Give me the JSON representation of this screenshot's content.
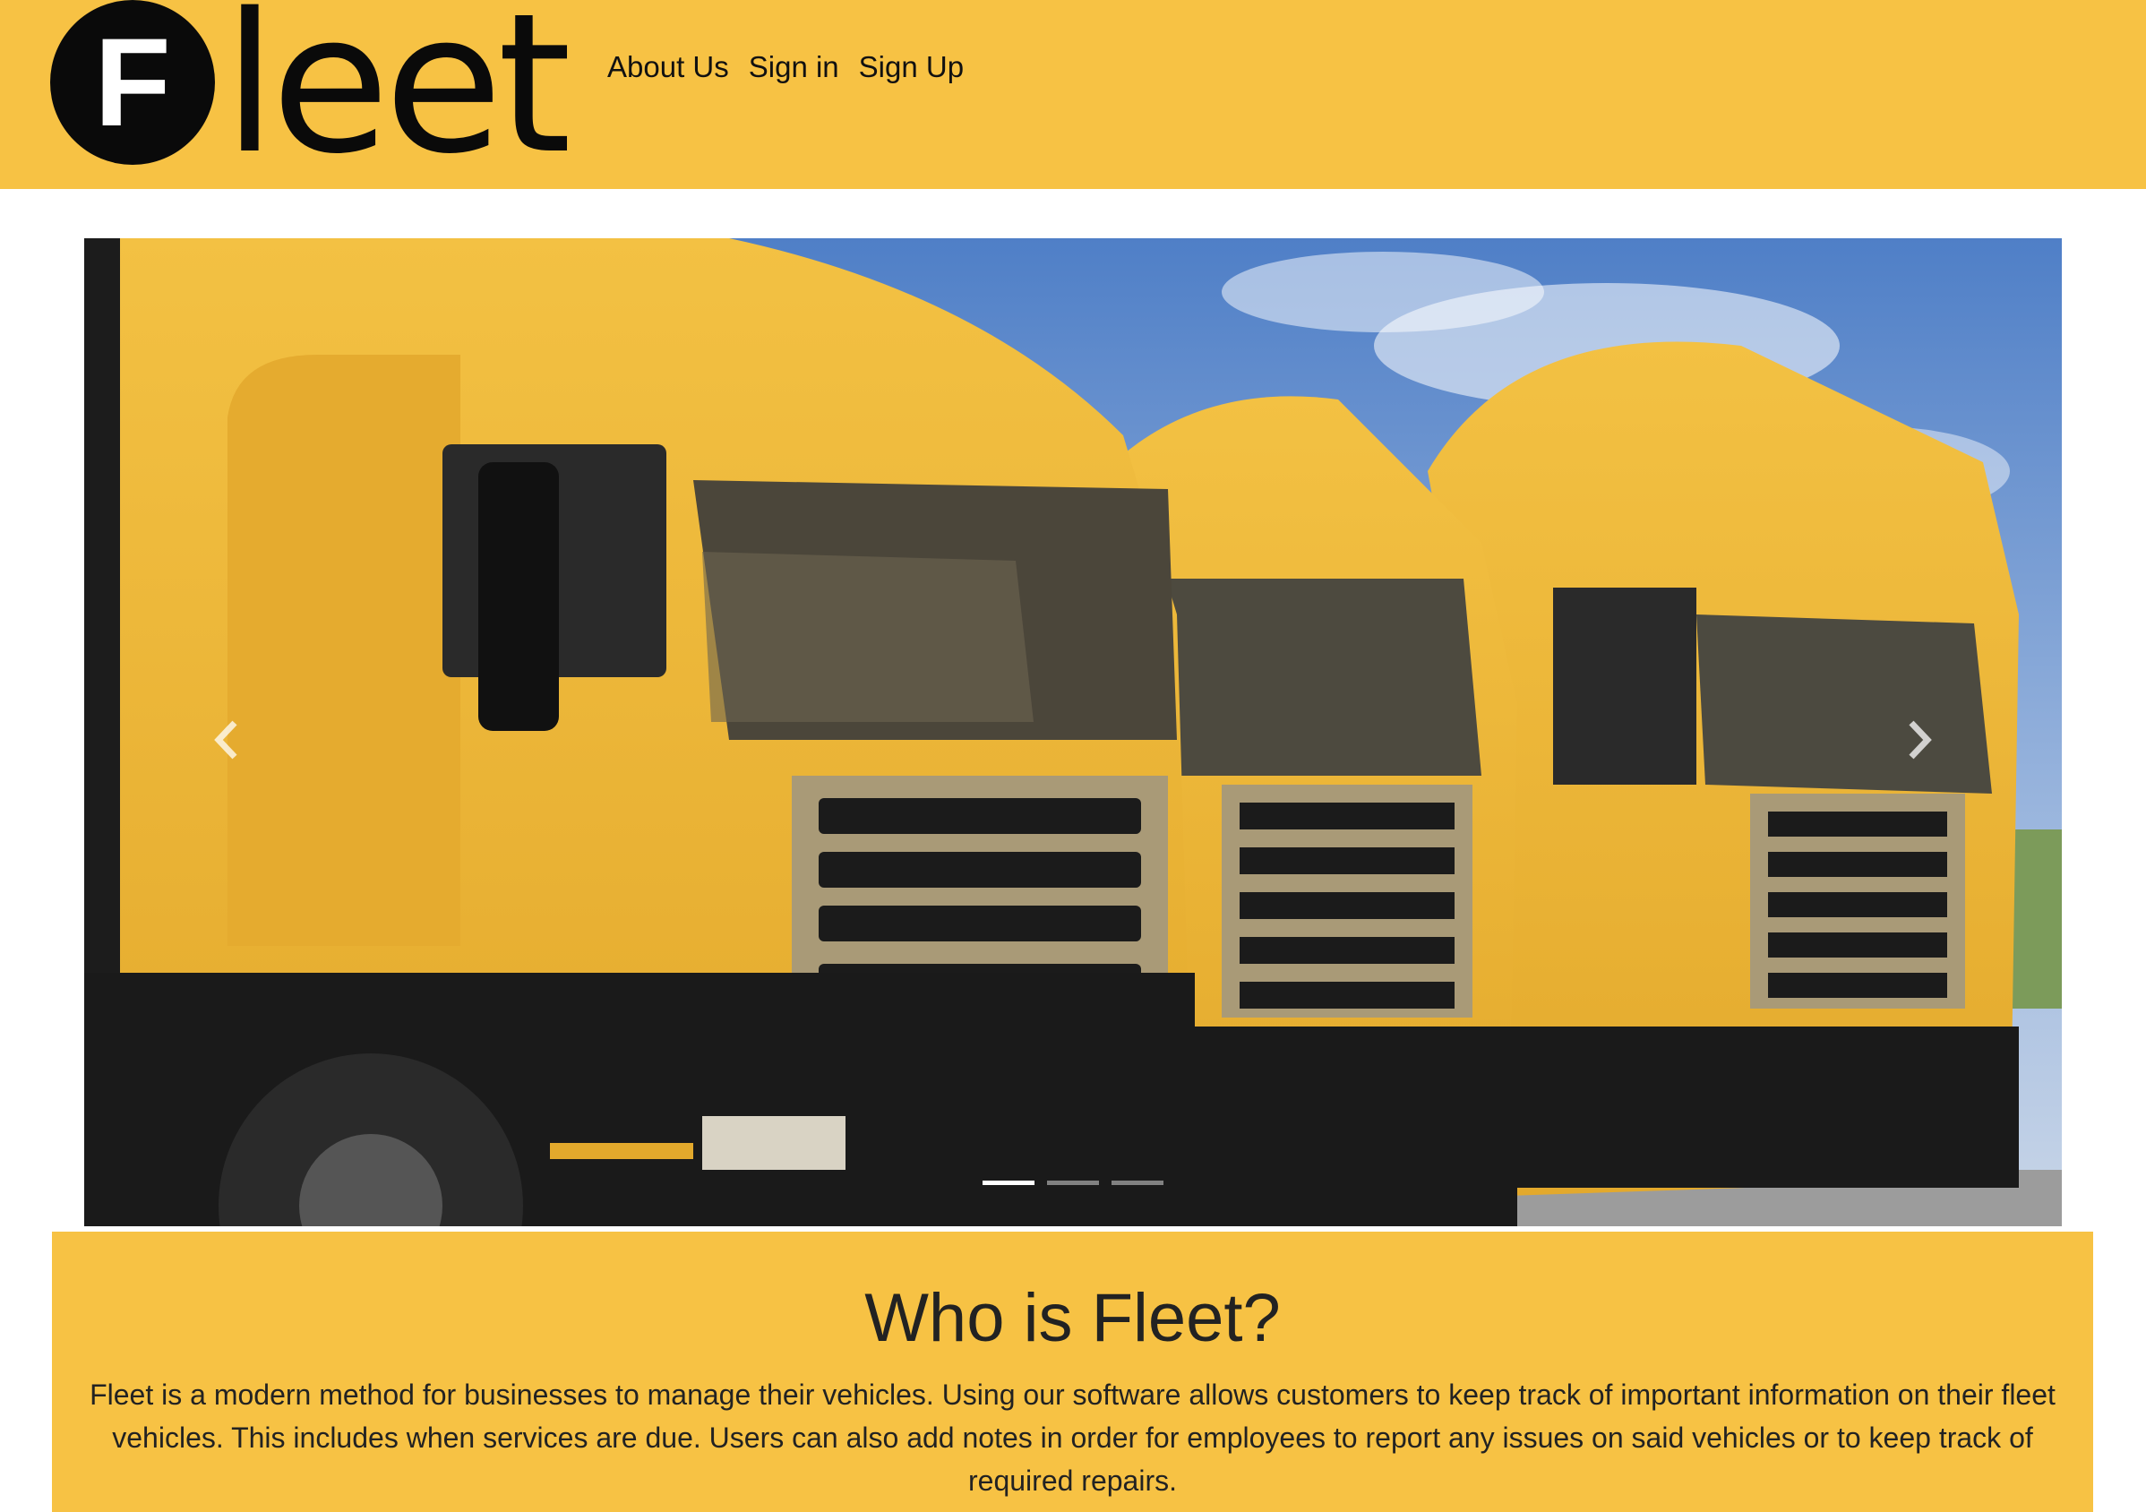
{
  "brand": {
    "logo_letter": "F",
    "logo_text": "leet"
  },
  "nav": {
    "items": [
      {
        "label": "About Us"
      },
      {
        "label": "Sign in"
      },
      {
        "label": "Sign Up"
      }
    ]
  },
  "carousel": {
    "prev_icon": "chevron-left-icon",
    "next_icon": "chevron-right-icon",
    "slide_count": 3,
    "active_slide": 1
  },
  "about": {
    "title": "Who is Fleet?",
    "body": "Fleet is a modern method for businesses to manage their vehicles. Using our software allows customers to keep track of important information on their fleet vehicles. This includes when services are due. Users can also add notes in order for employees to report any issues on said vehicles or to keep track of required repairs."
  },
  "colors": {
    "brand_yellow": "#f7c244",
    "text": "#222222"
  }
}
